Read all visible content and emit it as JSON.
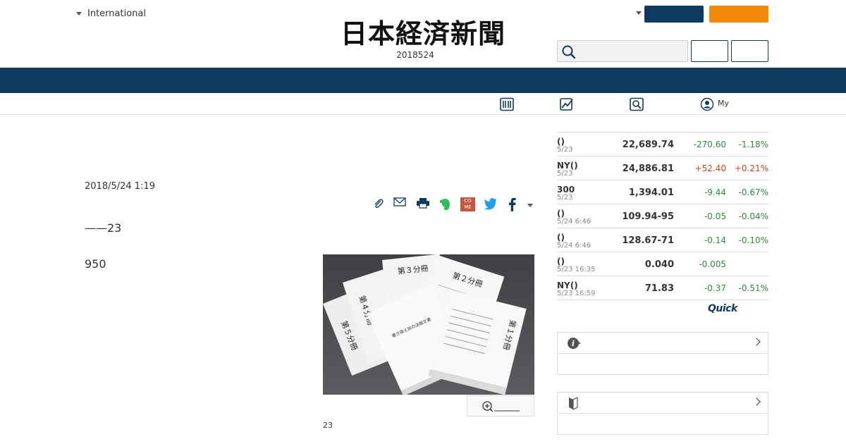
{
  "header": {
    "region_label": "International",
    "logo_text": "日本経済新聞",
    "date": "2018524",
    "search": {
      "placeholder": ""
    },
    "icons": [
      "caret-down-icon",
      "search-icon"
    ],
    "colors": {
      "navy": "#0d3a5e",
      "orange": "#f5890a"
    }
  },
  "subnav": {
    "my_label": "My",
    "icons": [
      "newspaper-icon",
      "chart-icon",
      "search-icon",
      "user-icon"
    ]
  },
  "article": {
    "date": "2018/5/24 1:19",
    "paragraphs": [
      "——23",
      "950"
    ],
    "photo": {
      "booklet_labels": [
        "第５分冊",
        "第４分冊",
        "第３分冊",
        "第２分冊",
        "第１分冊"
      ]
    },
    "caption": "23",
    "share_icons": [
      "clip-icon",
      "mail-icon",
      "print-icon",
      "evernote-icon",
      "come-icon",
      "twitter-icon",
      "facebook-icon",
      "caret-down-icon"
    ],
    "come_label": "CO ME"
  },
  "market": {
    "rows": [
      {
        "name": "()",
        "time": "5/23",
        "value": "22,689.74",
        "change": "-270.60",
        "pct": "-1.18%",
        "dir": "down"
      },
      {
        "name": "NY()",
        "time": "5/23",
        "value": "24,886.81",
        "change": "+52.40",
        "pct": "+0.21%",
        "dir": "up"
      },
      {
        "name": "300",
        "time": "5/23",
        "value": "1,394.01",
        "change": "-9.44",
        "pct": "-0.67%",
        "dir": "down"
      },
      {
        "name": "()",
        "time": "5/24 6:46",
        "value": "109.94-95",
        "change": "-0.05",
        "pct": "-0.04%",
        "dir": "down"
      },
      {
        "name": "()",
        "time": "5/24 6:46",
        "value": "128.67-71",
        "change": "-0.14",
        "pct": "-0.10%",
        "dir": "down"
      },
      {
        "name": "()",
        "time": "5/23 16:35",
        "value": "0.040",
        "change": "-0.005",
        "pct": "",
        "dir": "down"
      },
      {
        "name": "NY()",
        "time": "5/23 16:59",
        "value": "71.83",
        "change": "-0.37",
        "pct": "-0.51%",
        "dir": "down"
      }
    ],
    "provider": "Quick",
    "colors": {
      "down": "#2e8b3d",
      "up": "#d1431c"
    }
  },
  "side_boxes": {
    "icons": [
      "info-icon",
      "beginner-mark-icon",
      "chevron-right-icon"
    ]
  }
}
